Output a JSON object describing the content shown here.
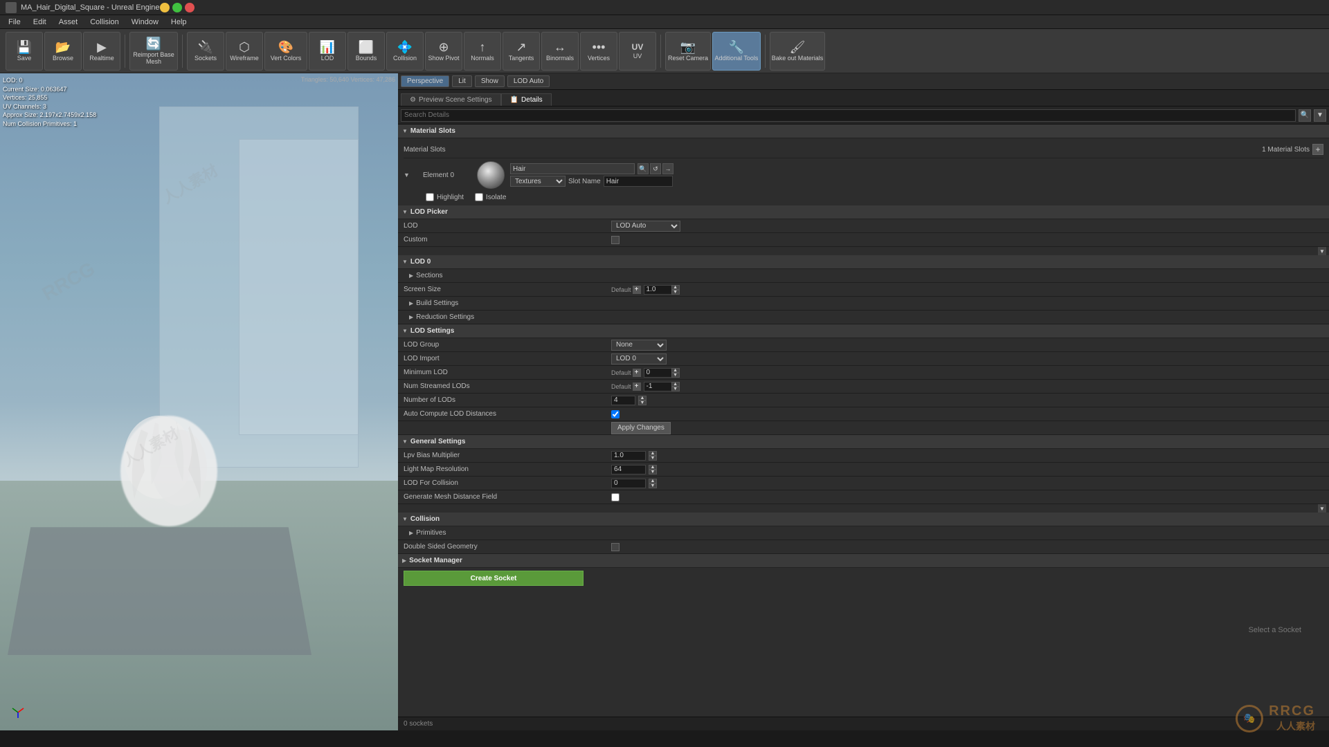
{
  "titleBar": {
    "title": "MA_Hair_Digital_Square - Unreal Engine",
    "minBtn": "─",
    "maxBtn": "□",
    "closeBtn": "✕"
  },
  "menuBar": {
    "items": [
      "File",
      "Edit",
      "Asset",
      "Collision",
      "Window",
      "Help"
    ]
  },
  "toolbar": {
    "buttons": [
      {
        "id": "save",
        "label": "Save",
        "icon": "💾"
      },
      {
        "id": "browse",
        "label": "Browse",
        "icon": "📂"
      },
      {
        "id": "realtime",
        "label": "Realtime",
        "icon": "▶"
      },
      {
        "id": "reimport",
        "label": "Reimport Base Mesh",
        "icon": "🔄"
      },
      {
        "id": "sockets",
        "label": "Sockets",
        "icon": "🔌"
      },
      {
        "id": "wireframe",
        "label": "Wireframe",
        "icon": "⬡"
      },
      {
        "id": "vert-colors",
        "label": "Vert Colors",
        "icon": "🎨"
      },
      {
        "id": "lod",
        "label": "LOD",
        "icon": "📊",
        "active": false
      },
      {
        "id": "bounds",
        "label": "Bounds",
        "icon": "⬜"
      },
      {
        "id": "collision",
        "label": "Collision",
        "icon": "💠"
      },
      {
        "id": "show-pivot",
        "label": "Show Pivot",
        "icon": "⊕"
      },
      {
        "id": "normals",
        "label": "Normals",
        "icon": "↑"
      },
      {
        "id": "tangents",
        "label": "Tangents",
        "icon": "↗"
      },
      {
        "id": "binormals",
        "label": "Binormals",
        "icon": "↔"
      },
      {
        "id": "vertices",
        "label": "Vertices",
        "icon": "•"
      },
      {
        "id": "uv",
        "label": "UV",
        "icon": "UV"
      },
      {
        "id": "reset-camera",
        "label": "Reset Camera",
        "icon": "📷"
      },
      {
        "id": "additional-tools",
        "label": "Additional Tools",
        "icon": "🔧",
        "active": true
      },
      {
        "id": "bake-out",
        "label": "Bake out Materials",
        "icon": "🖌"
      }
    ]
  },
  "modeBar": {
    "perspective": "Perspective",
    "lit": "Lit",
    "show": "Show",
    "lodAuto": "LOD Auto"
  },
  "viewport": {
    "info": {
      "lodLabel": "LOD: 0",
      "currentSize": "Current Size: 0.063647",
      "vertices": "Vertices: 25,855",
      "uvChannels": "UV Channels: 3",
      "approxSize": "Approx Size: 2.197x2.7459x2.158",
      "numCollision": "Num Collision Primitives: 1"
    },
    "triStats": "Triangles: 50,640  Vertices: 47,286"
  },
  "tabs": {
    "previewSceneSettings": "Preview Scene Settings",
    "details": "Details"
  },
  "search": {
    "placeholder": "Search Details"
  },
  "materialSlots": {
    "sectionTitle": "Material Slots",
    "labelTitle": "Material Slots",
    "count": "1 Material Slots",
    "element": "Element 0",
    "highlight": "Highlight",
    "isolate": "Isolate",
    "materialName": "Hair",
    "texturesLabel": "Textures",
    "slotNameLabel": "Slot Name",
    "slotName": "Hair"
  },
  "lodPicker": {
    "sectionTitle": "LOD Picker",
    "lodLabel": "LOD",
    "lodValue": "LOD Auto",
    "customLabel": "Custom"
  },
  "lod0": {
    "sectionTitle": "LOD 0",
    "sections": {
      "screenSize": "Screen Size",
      "default": "Default",
      "screenSizeValue": "1.0",
      "buildSettings": "Build Settings",
      "reductionSettings": "Reduction Settings"
    }
  },
  "lodSettings": {
    "sectionTitle": "LOD Settings",
    "lodGroup": {
      "label": "LOD Group",
      "value": "None"
    },
    "lodImport": {
      "label": "LOD Import",
      "value": "LOD 0"
    },
    "minimumLOD": {
      "label": "Minimum LOD",
      "default": "Default",
      "value": "0"
    },
    "numStreamedLODs": {
      "label": "Num Streamed LODs",
      "default": "Default",
      "value": "-1"
    },
    "numberOfLODs": {
      "label": "Number of LODs",
      "value": "4"
    },
    "autoComputeLOD": {
      "label": "Auto Compute LOD Distances",
      "checked": true
    },
    "applyChanges": "Apply Changes"
  },
  "generalSettings": {
    "sectionTitle": "General Settings",
    "lpvBiasMultiplier": {
      "label": "Lpv Bias Multiplier",
      "value": "1.0"
    },
    "lightMapResolution": {
      "label": "Light Map Resolution",
      "value": "64"
    },
    "lodForCollision": {
      "label": "LOD For Collision",
      "value": "0"
    },
    "generateMeshDistanceField": {
      "label": "Generate Mesh Distance Field",
      "checked": false
    }
  },
  "collision": {
    "sectionTitle": "Collision",
    "primitives": "Primitives",
    "doubleSidedGeometry": {
      "label": "Double Sided Geometry",
      "checked": false
    }
  },
  "socketManager": {
    "sectionTitle": "Socket Manager",
    "createSocketLabel": "Create Socket",
    "selectSocketText": "Select a Socket",
    "socketsCount": "0 sockets"
  },
  "colors": {
    "accent": "#5a9a3a",
    "activeToolbar": "#5a7a9a",
    "headerBg": "#3a3a3a",
    "panelBg": "#2d2d2d",
    "inputBg": "#1a1a1a"
  }
}
